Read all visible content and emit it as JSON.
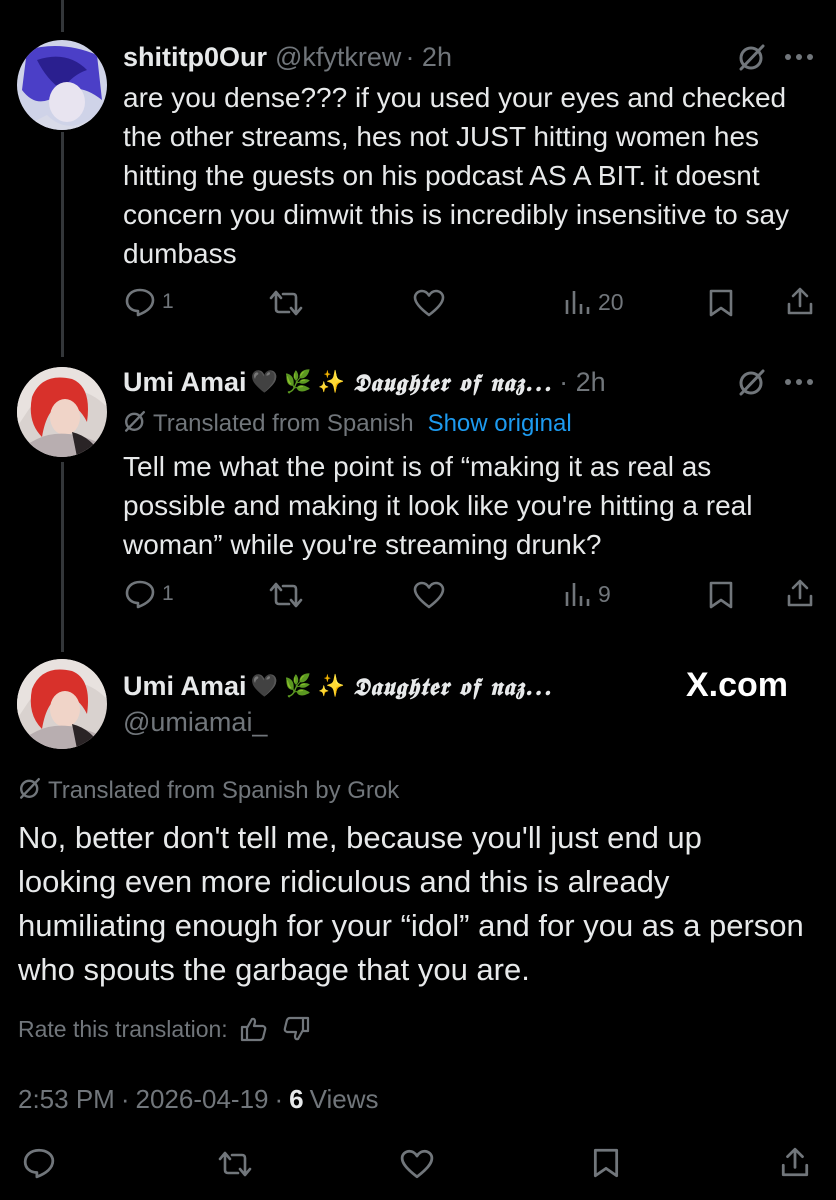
{
  "reply1": {
    "display_name": "shititp0Our",
    "handle": "@kfytkrew",
    "time": "· 2h",
    "text": "are you dense??? if you used your eyes and checked the other streams, hes not JUST hitting women hes hitting the guests on his podcast AS A BIT. it doesnt concern you dimwit this is incredibly insensitive to say dumbass",
    "actions": {
      "replies": "1",
      "views": "20"
    }
  },
  "reply2": {
    "display_name": "Umi Amai",
    "name_emojis": "🖤 🌿 ✨",
    "name_fancy": "𝕯𝖆𝖚𝖌𝖍𝖙𝖊𝖗 𝖔𝖋 𝖓𝖆𝖟...",
    "time": "· 2h",
    "translated_label": "Translated from Spanish",
    "show_original": "Show original",
    "text": "Tell me what the point is of “making it as real as possible and making it look like you're hitting a real woman” while you're streaming drunk?",
    "actions": {
      "replies": "1",
      "views": "9"
    }
  },
  "main": {
    "display_name": "Umi Amai",
    "name_emojis": "🖤 🌿 ✨",
    "name_fancy": "𝕯𝖆𝖚𝖌𝖍𝖙𝖊𝖗 𝖔𝖋 𝖓𝖆𝖟...",
    "handle": "@umiamai_",
    "watermark": "X.com",
    "translated_label": "Translated from Spanish by Grok",
    "text": "No, better don't tell me, because you'll just end up looking even more ridiculous and this is already humiliating enough for your “idol” and for you as a person who spouts the garbage that you are.",
    "rate_label": "Rate this translation:",
    "time": "2:53 PM",
    "date": "2026-04-19",
    "views_count": "6",
    "views_label": "Views"
  },
  "colors": {
    "accent": "#1d9bf0",
    "muted": "#71767b",
    "text": "#e7e9ea",
    "background": "#000000"
  },
  "icons": [
    "reply-icon",
    "retweet-icon",
    "like-icon",
    "views-icon",
    "bookmark-icon",
    "share-icon",
    "grok-icon",
    "more-icon",
    "thumbs-up-icon",
    "thumbs-down-icon"
  ]
}
